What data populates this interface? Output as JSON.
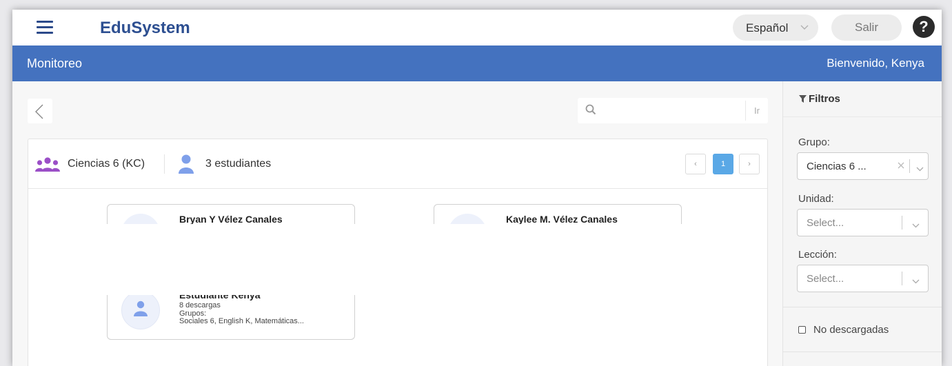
{
  "header": {
    "brand": "EduSystem",
    "language": "Español",
    "logout": "Salir",
    "help": "?"
  },
  "subheader": {
    "title": "Monitoreo",
    "welcome": "Bienvenido, Kenya"
  },
  "toolbar": {
    "search_placeholder": "",
    "search_go": "Ir"
  },
  "group": {
    "name": "Ciencias 6 (KC)",
    "students": "3 estudiantes",
    "pagination": {
      "prev": "‹",
      "page": "1",
      "next": "›"
    }
  },
  "students": [
    {
      "name": "Bryan Y Vélez Canales"
    },
    {
      "name": "Kaylee M. Vélez Canales"
    },
    {
      "name": "Estudiante Kenya",
      "downloads": "8 descargas",
      "groups_label": "Grupos:",
      "groups": "Sociales 6, English K, Matemáticas..."
    }
  ],
  "filters": {
    "title": "Filtros",
    "group_label": "Grupo:",
    "group_value": "Ciencias 6 ...",
    "unit_label": "Unidad:",
    "unit_placeholder": "Select...",
    "lesson_label": "Lección:",
    "lesson_placeholder": "Select...",
    "not_downloaded": "No descargadas"
  },
  "colors": {
    "brand": "#2d4f91",
    "subheader_bg": "#4472bf",
    "group_icon": "#9b4fc7",
    "user_icon": "#7fa0ea",
    "active_page": "#5aa8e6"
  }
}
